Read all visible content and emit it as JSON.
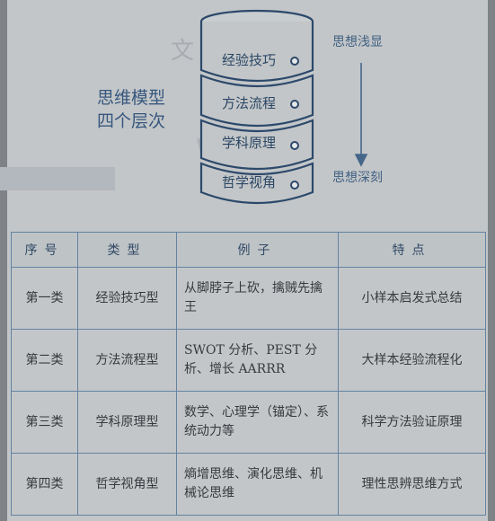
{
  "diagram": {
    "title_lines": [
      "思维模型",
      "四个层次"
    ],
    "layers": [
      "经验技巧",
      "方法流程",
      "学科原理",
      "哲学视角"
    ],
    "arrow": {
      "top_label": "思想浅显",
      "bottom_label": "思想深刻"
    },
    "colors": {
      "accent": "#3a5e89",
      "stroke": "#2f4e74"
    }
  },
  "table": {
    "headers": [
      "序号",
      "类型",
      "例子",
      "特点"
    ],
    "rows": [
      {
        "index": "第一类",
        "type": "经验技巧型",
        "example": "从脚脖子上砍，擒贼先擒王",
        "feature": "小样本启发式总结"
      },
      {
        "index": "第二类",
        "type": "方法流程型",
        "example": "SWOT 分析、PEST 分析、增长 AARRR",
        "feature": "大样本经验流程化"
      },
      {
        "index": "第三类",
        "type": "学科原理型",
        "example": "数学、心理学（锚定）、系统动力等",
        "feature": "科学方法验证原理"
      },
      {
        "index": "第四类",
        "type": "哲学视角型",
        "example": "熵增思维、演化思维、机械论思维",
        "feature": "理性思辨思维方式"
      }
    ]
  }
}
